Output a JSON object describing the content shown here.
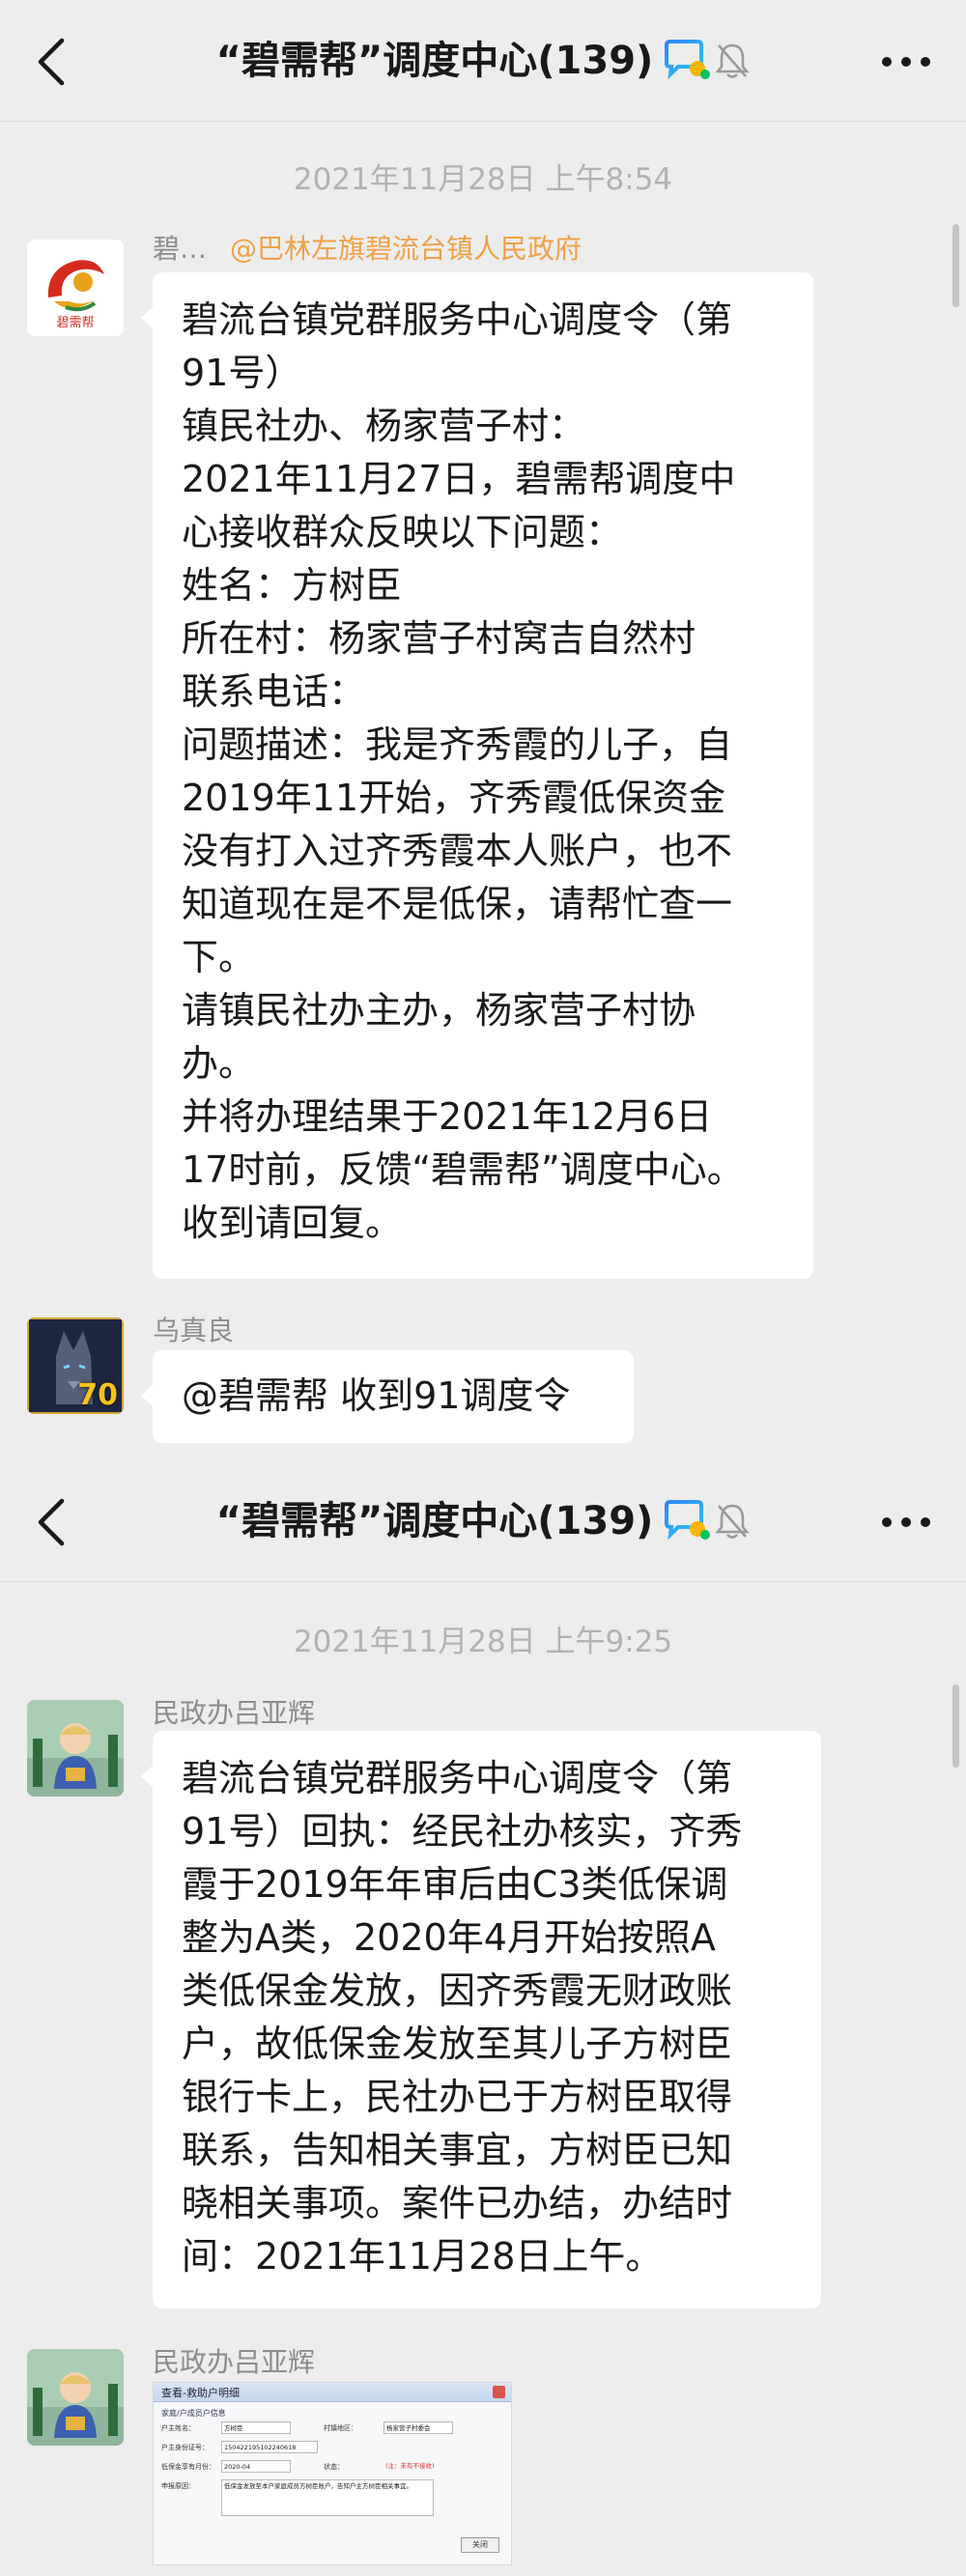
{
  "app": {
    "nav_title": "“碧需帮”调度中心(139)",
    "icons": [
      "back-arrow-icon",
      "group-chat-icon",
      "mute-bell-icon",
      "more-dots-icon"
    ]
  },
  "section1": {
    "timestamp": "2021年11月28日 上午8:54",
    "msg1": {
      "sender": "碧…",
      "mention": "@巴林左旗碧流台镇人民政府",
      "avatar_text": "碧需帮",
      "lines": [
        "碧流台镇党群服务中心调度令（第",
        "91号）",
        "镇民社办、杨家营子村：",
        "2021年11月27日，碧需帮调度中",
        "心接收群众反映以下问题：",
        "姓名：方树臣",
        "所在村：杨家营子村窝吉自然村",
        "联系电话：",
        "问题描述：我是齐秀霞的儿子，自",
        "2019年11开始，齐秀霞低保资金",
        "没有打入过齐秀霞本人账户，也不",
        "知道现在是不是低保，请帮忙查一",
        "下。",
        "请镇民社办主办，杨家营子村协",
        "办。",
        "并将办理结果于2021年12月6日",
        "17时前，反馈“碧需帮”调度中心。",
        "收到请回复。"
      ]
    },
    "msg2": {
      "sender": "乌真良",
      "avatar_badge": "70",
      "text": "@碧需帮 收到91调度令"
    }
  },
  "section2": {
    "timestamp": "2021年11月28日 上午9:25",
    "msg1": {
      "sender": "民政办吕亚辉",
      "lines": [
        "碧流台镇党群服务中心调度令（第",
        "91号）回执：经民社办核实，齐秀",
        "霞于2019年年审后由C3类低保调",
        "整为A类，2020年4月开始按照A",
        "类低保金发放，因齐秀霞无财政账",
        "户，故低保金发放至其儿子方树臣",
        "银行卡上，民社办已于方树臣取得",
        "联系，告知相关事宜，方树臣已知",
        "晓相关事项。案件已办结，办结时",
        "间：2021年11月28日上午。"
      ]
    },
    "msg2": {
      "sender": "民政办吕亚辉",
      "image": {
        "title": "查看-救助户明细",
        "section": "家庭/户成员户信息",
        "fields": [
          {
            "label": "户主姓名：",
            "value": "方树臣"
          },
          {
            "label": "村镇地区：",
            "value": "杨家营子村委会"
          },
          {
            "label": "户主身份证号：",
            "value": "150422195102240618"
          },
          {
            "label": "低保金享有月份：",
            "value": "2020-04"
          },
          {
            "label": "状态：",
            "value": "(注：未有不接收)"
          },
          {
            "label": "申报原因：",
            "value": "低保金发放至本户家庭成员方树臣账户，告知户主方树臣相关事宜。"
          }
        ],
        "close_button": "关闭"
      }
    }
  },
  "colors": {
    "background": "#ededed",
    "bubble": "#ffffff",
    "timestamp": "#b2b2b2",
    "sender": "#8c8c8c",
    "mention": "#f0a045",
    "text": "#191919"
  }
}
